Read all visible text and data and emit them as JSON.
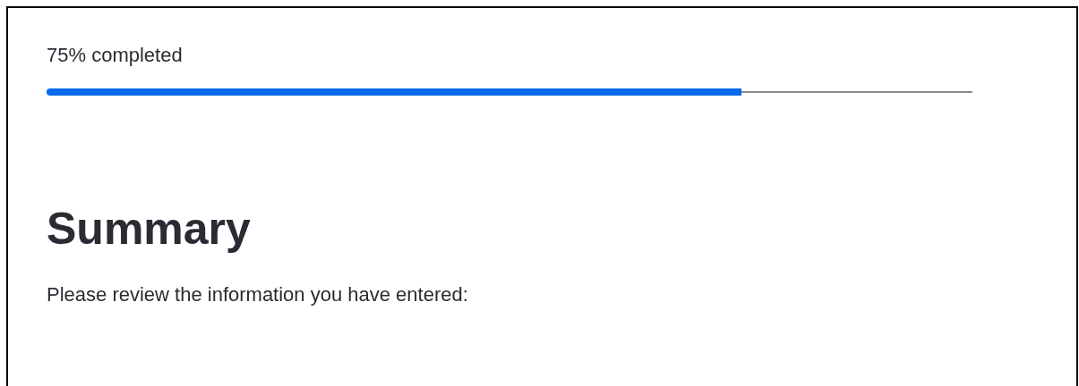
{
  "progress": {
    "label": "75% completed",
    "level": 0.75
  },
  "heading": "Summary",
  "intro": "Please review the information you have entered:"
}
